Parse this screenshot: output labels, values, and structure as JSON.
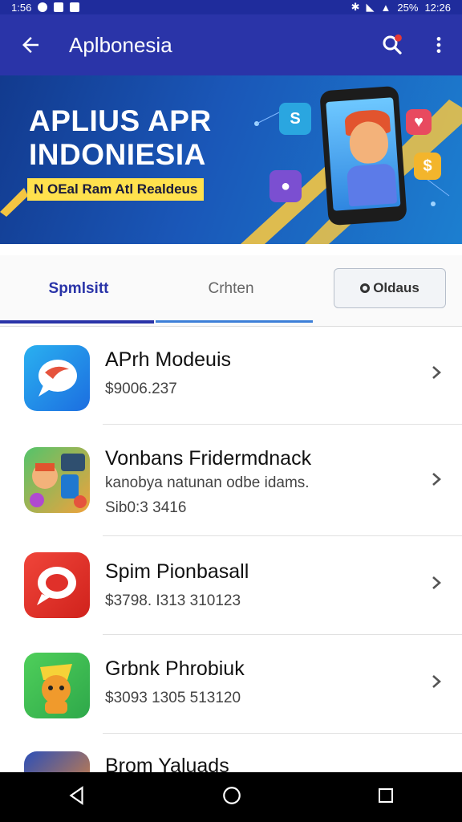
{
  "status_bar": {
    "time_left": "1:56",
    "battery": "25%",
    "time_right": "12:26"
  },
  "app_bar": {
    "title": "Aplbonesia"
  },
  "banner": {
    "headline_line1": "APLIUS APR",
    "headline_line2": "INDONIESIA",
    "tagline": "N OEal Ram Atl Realdeus"
  },
  "tabs": [
    {
      "label": "Spmlsitt"
    },
    {
      "label": "Crhten"
    },
    {
      "label": "Oldaus"
    }
  ],
  "apps": [
    {
      "name": "APrh Modeuis",
      "line1": "$9006.237",
      "line2": ""
    },
    {
      "name": "Vonbans Fridermdnack",
      "line1": "kanobya natunan odbe idams.",
      "line2": "Sib0:3 3416"
    },
    {
      "name": "Spim Pionbasall",
      "line1": "$3798. I313 310123",
      "line2": ""
    },
    {
      "name": "Grbnk Phrobiuk",
      "line1": "$3093 1305 513120",
      "line2": ""
    },
    {
      "name": "Brom Yaluads",
      "line1": "",
      "line2": ""
    }
  ],
  "colors": {
    "app_bar": "#2a34a8",
    "accent": "#2a34a8",
    "tab_underline": "#3d7fd8"
  }
}
